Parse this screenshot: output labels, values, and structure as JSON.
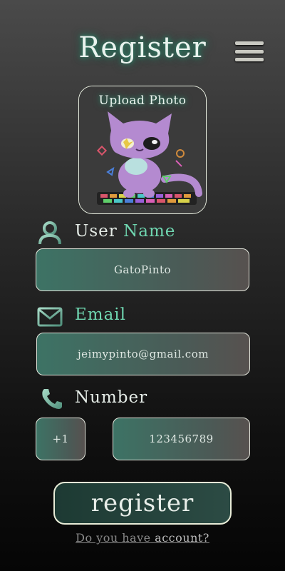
{
  "header": {
    "title": "Register"
  },
  "photo": {
    "label": "Upload Photo"
  },
  "username": {
    "label_main": "User",
    "label_accent": "Name",
    "value": "GatoPinto"
  },
  "email": {
    "label": "Email",
    "value": "jeimypinto@gmail.com"
  },
  "number": {
    "label": "Number",
    "country_code": "+1",
    "value": "123456789"
  },
  "actions": {
    "register_label": "register",
    "account_prefix": "Do you have",
    "account_link": "account?"
  },
  "colors": {
    "accent": "#6fd6b0",
    "glow": "#2f7a63",
    "input_bg": "#3d7365"
  },
  "icons": [
    "menu-icon",
    "user-icon",
    "mail-icon",
    "phone-icon"
  ]
}
